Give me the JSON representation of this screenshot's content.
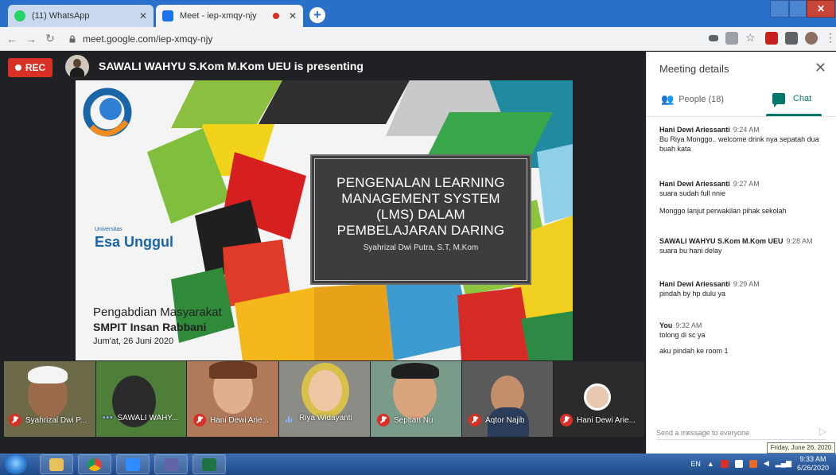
{
  "browser": {
    "tabs": [
      {
        "title": "(11) WhatsApp",
        "active": false,
        "favicon": "whatsapp-icon",
        "color": "#25d366"
      },
      {
        "title": "Meet - iep-xmqy-njy",
        "active": true,
        "favicon": "meet-icon",
        "color": "#1a73e8"
      }
    ],
    "url": "meet.google.com/iep-xmqy-njy"
  },
  "meet": {
    "rec_label": "REC",
    "presenting": "SAWALI WAHYU S.Kom M.Kom UEU is presenting",
    "slide": {
      "title_lines": [
        "PENGENALAN LEARNING",
        "MANAGEMENT SYSTEM",
        "(LMS) DALAM",
        "PEMBELAJARAN DARING"
      ],
      "author": "Syahrizal Dwi Putra, S.T, M.Kom",
      "logo_small": "Universitas",
      "logo_name": "Esa Unggul",
      "line1": "Pengabdian Masyarakat",
      "line2": "SMPIT Insan Rabbani",
      "line3": "Jum'at, 26 Juni 2020"
    },
    "participants": [
      {
        "name": "Syahrizal Dwi P...",
        "status": "muted"
      },
      {
        "name": "SAWALI WAHY...",
        "status": "dots"
      },
      {
        "name": "Hani Dewi Arie...",
        "status": "muted"
      },
      {
        "name": "Riya Widayanti",
        "status": "talking"
      },
      {
        "name": "Septian Nu",
        "status": "muted"
      },
      {
        "name": "Aqtor Najib",
        "status": "muted"
      },
      {
        "name": "Hani Dewi Arie...",
        "status": "muted"
      }
    ]
  },
  "panel": {
    "title": "Meeting details",
    "people_tab": "People (18)",
    "chat_tab": "Chat",
    "messages": [
      {
        "sender": "Hani Dewi Ariessanti",
        "time": "9:24 AM",
        "lines": [
          "Bu Riya Monggo.. welcome drink nya sepatah dua buah kata"
        ]
      },
      {
        "sender": "Hani Dewi Ariessanti",
        "time": "9:27 AM",
        "lines": [
          "suara sudah full nnie",
          "Monggo lanjut perwakilan pihak sekolah"
        ]
      },
      {
        "sender": "SAWALI WAHYU S.Kom M.Kom UEU",
        "time": "9:28 AM",
        "lines": [
          "suara bu hani delay"
        ]
      },
      {
        "sender": "Hani Dewi Ariessanti",
        "time": "9:29 AM",
        "lines": [
          "pindah by hp dulu ya"
        ]
      },
      {
        "sender": "You",
        "time": "9:32 AM",
        "lines": [
          "tolong di sc ya",
          "aku pindah ke room 1"
        ]
      }
    ],
    "compose_placeholder": "Send a message to everyone",
    "date_tooltip": "Friday, June 26, 2020"
  },
  "taskbar": {
    "lang": "EN",
    "time": "9:33 AM",
    "date": "6/26/2020"
  }
}
